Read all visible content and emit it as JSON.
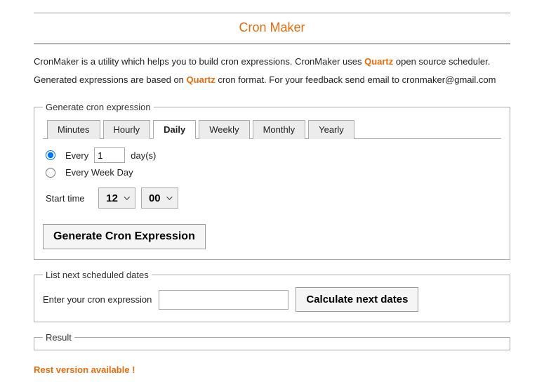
{
  "title": "Cron Maker",
  "intro": {
    "part1": "CronMaker is a utility which helps you to build cron expressions. CronMaker uses ",
    "link1": "Quartz",
    "part2": " open source scheduler. Generated expressions are based on ",
    "link2": "Quartz",
    "part3": " cron format. For your feedback send email to ",
    "email": "cronmaker@gmail.com"
  },
  "gen": {
    "legend": "Generate cron expression",
    "tabs": {
      "minutes": "Minutes",
      "hourly": "Hourly",
      "daily": "Daily",
      "weekly": "Weekly",
      "monthly": "Monthly",
      "yearly": "Yearly"
    },
    "everyPrefix": "Every",
    "everyValue": "1",
    "everySuffix": "day(s)",
    "everyWeekday": "Every Week Day",
    "startTimeLabel": "Start time",
    "hour": "12",
    "minute": "00",
    "button": "Generate Cron Expression"
  },
  "list": {
    "legend": "List next scheduled dates",
    "label": "Enter your cron expression",
    "value": "",
    "button": "Calculate next dates"
  },
  "result": {
    "legend": "Result"
  },
  "restLink": "Rest version available !"
}
